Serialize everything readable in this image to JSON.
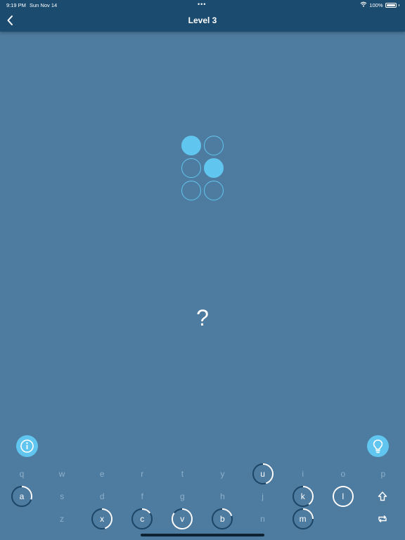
{
  "status_bar": {
    "time": "9:19 PM",
    "date": "Sun Nov 14",
    "battery": "100%",
    "dots": "•••"
  },
  "header": {
    "title": "Level 3"
  },
  "braille": {
    "dots_filled": [
      true,
      false,
      false,
      false,
      true,
      false
    ]
  },
  "answer": {
    "placeholder": "?"
  },
  "colors": {
    "accent": "#60c6ef",
    "header_bg": "#1b4c70",
    "background": "#4e7ba0",
    "dim_key": "#8eb0ca"
  },
  "buttons": {
    "info_icon": "info-icon",
    "hint_icon": "lightbulb-icon"
  },
  "keyboard": {
    "row1": [
      {
        "letter": "q",
        "state": "dim"
      },
      {
        "letter": "w",
        "state": "dim"
      },
      {
        "letter": "e",
        "state": "dim"
      },
      {
        "letter": "r",
        "state": "dim"
      },
      {
        "letter": "t",
        "state": "dim"
      },
      {
        "letter": "y",
        "state": "dim"
      },
      {
        "letter": "u",
        "state": "active",
        "progress": 0.45
      },
      {
        "letter": "i",
        "state": "dim"
      },
      {
        "letter": "o",
        "state": "dim"
      },
      {
        "letter": "p",
        "state": "dim"
      }
    ],
    "row2": [
      {
        "letter": "a",
        "state": "active",
        "progress": 0.3
      },
      {
        "letter": "s",
        "state": "dim"
      },
      {
        "letter": "d",
        "state": "dim"
      },
      {
        "letter": "f",
        "state": "dim"
      },
      {
        "letter": "g",
        "state": "dim"
      },
      {
        "letter": "h",
        "state": "dim"
      },
      {
        "letter": "j",
        "state": "dim"
      },
      {
        "letter": "k",
        "state": "active",
        "progress": 0.4
      },
      {
        "letter": "l",
        "state": "active",
        "progress": 1.0
      }
    ],
    "row3": [
      {
        "letter": "z",
        "state": "dim"
      },
      {
        "letter": "x",
        "state": "active",
        "progress": 0.45
      },
      {
        "letter": "c",
        "state": "active",
        "progress": 0.15
      },
      {
        "letter": "v",
        "state": "active",
        "progress": 0.85
      },
      {
        "letter": "b",
        "state": "active",
        "progress": 0.2
      },
      {
        "letter": "n",
        "state": "dim"
      },
      {
        "letter": "m",
        "state": "active",
        "progress": 0.25
      }
    ],
    "shift_icon": "shift-icon",
    "switch_icon": "switch-icon"
  }
}
